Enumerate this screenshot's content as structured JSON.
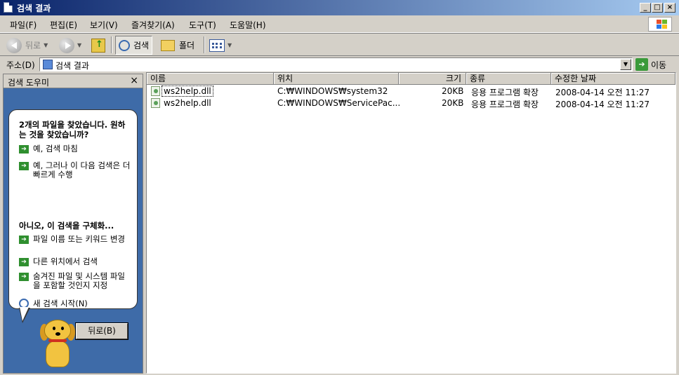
{
  "window": {
    "title": "검색 결과"
  },
  "menu": [
    "파일(F)",
    "편집(E)",
    "보기(V)",
    "즐겨찾기(A)",
    "도구(T)",
    "도움말(H)"
  ],
  "toolbar": {
    "back": "뒤로",
    "search": "검색",
    "folders": "폴더"
  },
  "address": {
    "label": "주소(D)",
    "value": "검색 결과",
    "go": "이동"
  },
  "assistant": {
    "title": "검색 도우미",
    "found": "2개의 파일을 찾았습니다. 원하는 것을 찾았습니까?",
    "yes_finish": "예, 검색 마침",
    "yes_faster": "예, 그러나 이 다음 검색은 더 빠르게 수행",
    "refine_heading": "아니오, 이 검색을 구체화...",
    "change_name": "파일 이름 또는 키워드 변경",
    "other_location": "다른 위치에서 검색",
    "hidden_files": "숨겨진 파일 및 시스템 파일을 포함할 것인지 지정",
    "new_search": "새 검색 시작(N)",
    "back_button": "뒤로(B)"
  },
  "columns": [
    "이름",
    "위치",
    "크기",
    "종류",
    "수정한 날짜"
  ],
  "files": [
    {
      "name": "ws2help.dll",
      "location": "C:₩WINDOWS₩system32",
      "size": "20KB",
      "type": "응용 프로그램 확장",
      "modified": "2008-04-14 오전 11:27"
    },
    {
      "name": "ws2help.dll",
      "location": "C:₩WINDOWS₩ServicePac...",
      "size": "20KB",
      "type": "응용 프로그램 확장",
      "modified": "2008-04-14 오전 11:27"
    }
  ]
}
